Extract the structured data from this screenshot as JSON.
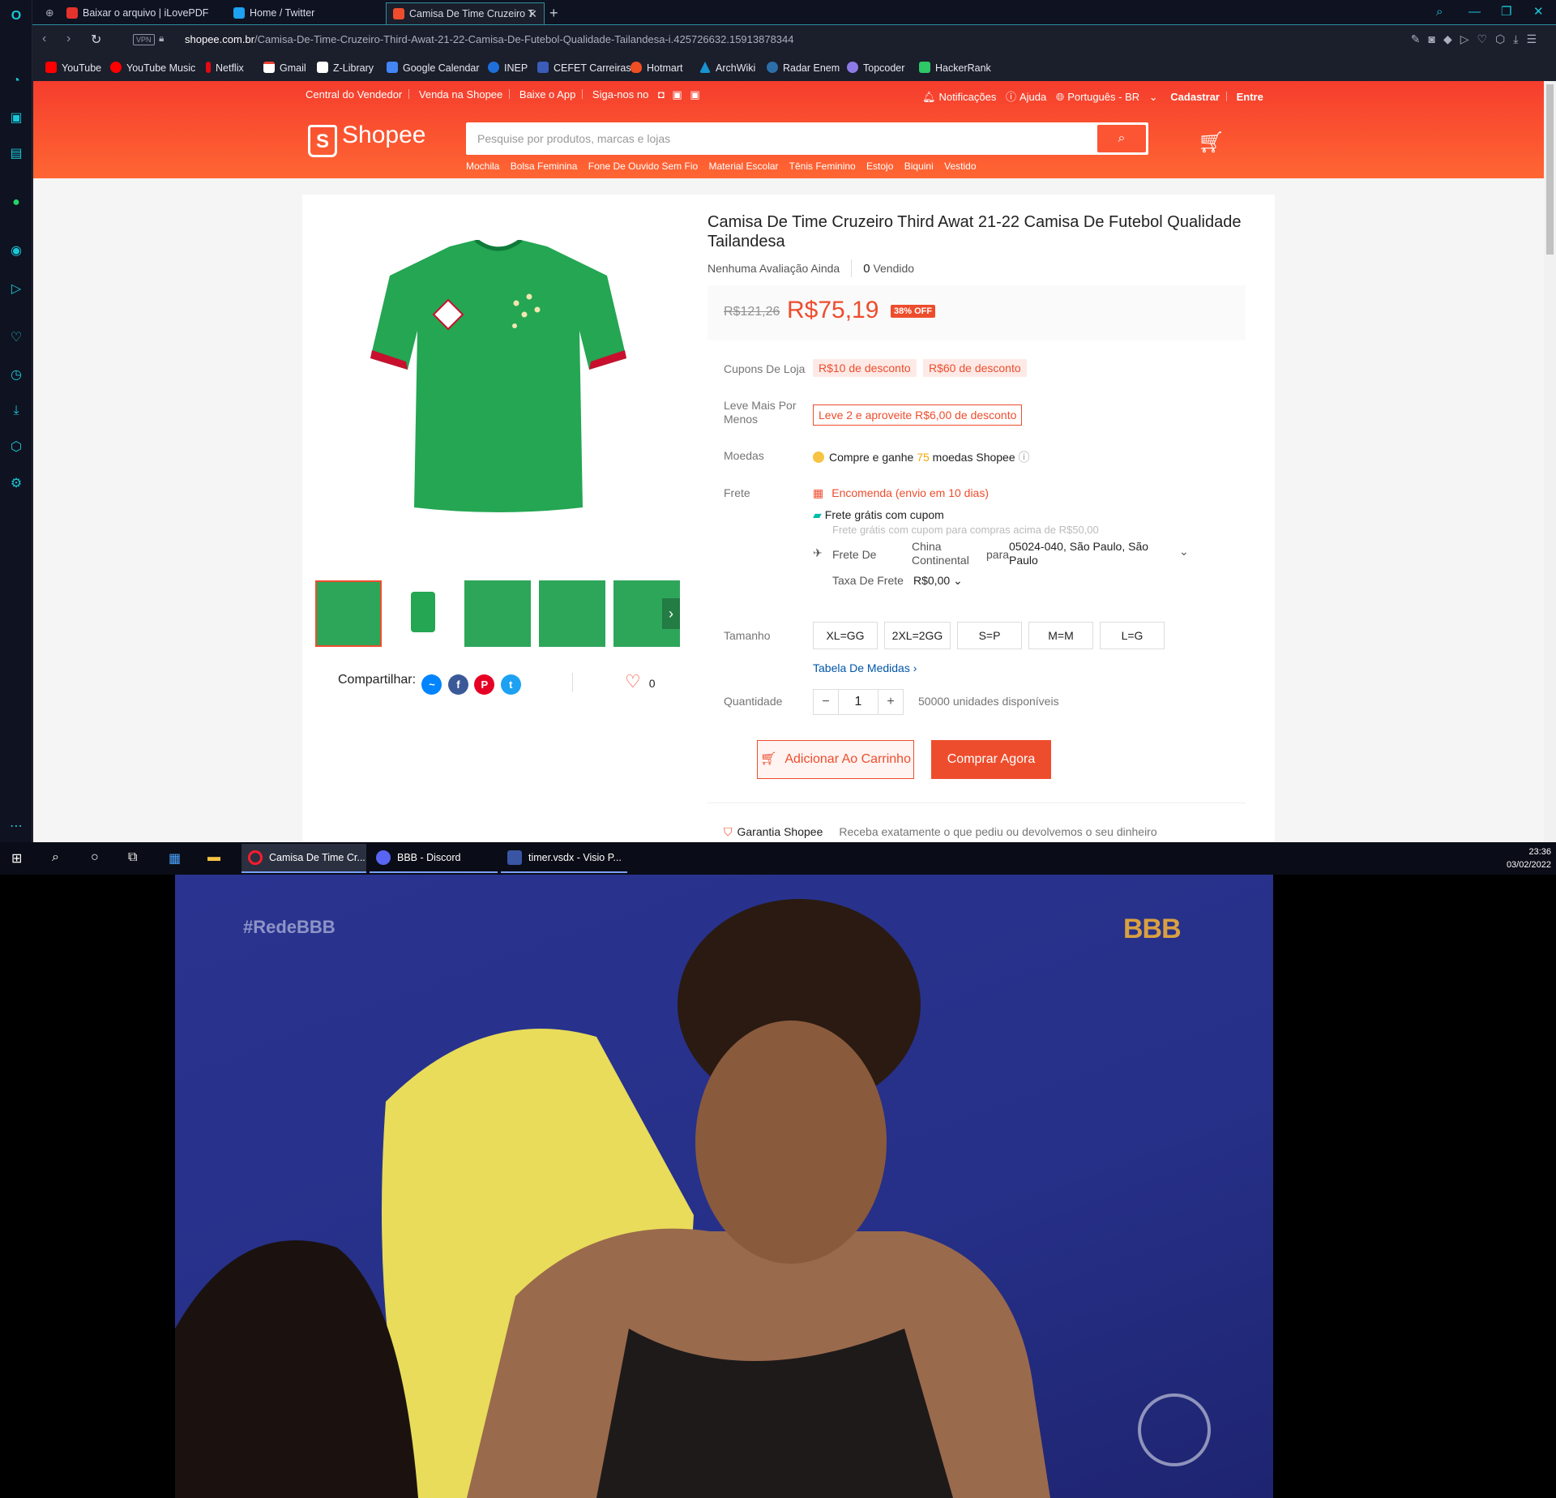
{
  "browser": {
    "tabs": [
      {
        "label": "Baixar o arquivo | iLovePDF"
      },
      {
        "label": "Home / Twitter"
      },
      {
        "label": "Camisa De Time Cruzeiro T"
      }
    ],
    "address": {
      "vpn": "VPN",
      "domain": "shopee.com.br",
      "path": "/Camisa-De-Time-Cruzeiro-Third-Awat-21-22-Camisa-De-Futebol-Qualidade-Tailandesa-i.425726632.15913878344"
    },
    "bookmarks": [
      "YouTube",
      "YouTube Music",
      "Netflix",
      "Gmail",
      "Z-Library",
      "Google Calendar",
      "INEP",
      "CEFET Carreiras",
      "Hotmart",
      "ArchWiki",
      "Radar Enem",
      "Topcoder",
      "HackerRank"
    ]
  },
  "shopee": {
    "topnav_left": [
      "Central do Vendedor",
      "Venda na Shopee",
      "Baixe o App",
      "Siga-nos no"
    ],
    "topnav_right": [
      "Notificações",
      "Ajuda",
      "Português - BR",
      "Cadastrar",
      "Entre"
    ],
    "logo": "Shopee",
    "search_placeholder": "Pesquise por produtos, marcas e lojas",
    "suggestions": [
      "Mochila",
      "Bolsa Feminina",
      "Fone De Ouvido Sem Fio",
      "Material Escolar",
      "Tênis Feminino",
      "Estojo",
      "Biquini",
      "Vestido"
    ]
  },
  "product": {
    "title": "Camisa De Time Cruzeiro Third Awat 21-22 Camisa De Futebol Qualidade Tailandesa",
    "rating": "Nenhuma Avaliação Ainda",
    "sold_count": "0",
    "sold_label": "Vendido",
    "old_price": "R$121,26",
    "price": "R$75,19",
    "discount": "38% OFF",
    "coupons_label": "Cupons De Loja",
    "coupons": [
      "R$10 de desconto",
      "R$60 de desconto"
    ],
    "combo_label": "Leve Mais Por Menos",
    "combo": "Leve 2 e aproveite R$6,00 de desconto",
    "coins_label": "Moedas",
    "coins_pre": "Compre e ganhe",
    "coins_amount": "75",
    "coins_post": "moedas Shopee",
    "shipping_label": "Frete",
    "shipping_eta": "Encomenda (envio em 10 dias)",
    "free_shipping": "Frete grátis com cupom",
    "free_shipping_note": "Frete grátis com cupom para compras acima de R$50,00",
    "ship_from_label": "Frete De",
    "ship_from": "China Continental",
    "ship_to_label": "para",
    "ship_to": "05024-040, São Paulo, São Paulo",
    "ship_fee_label": "Taxa De Frete",
    "ship_fee": "R$0,00",
    "size_label": "Tamanho",
    "sizes": [
      "XL=GG",
      "2XL=2GG",
      "S=P",
      "M=M",
      "L=G"
    ],
    "size_table": "Tabela De Medidas",
    "qty_label": "Quantidade",
    "qty_value": "1",
    "stock": "50000 unidades disponíveis",
    "add_to_cart": "Adicionar Ao Carrinho",
    "buy_now": "Comprar Agora",
    "guarantee_title": "Garantia Shopee",
    "guarantee_text": "Receba exatamente o que pediu ou devolvemos o seu dinheiro",
    "share_label": "Compartilhar:",
    "likes": "0"
  },
  "taskbar": {
    "apps": [
      "Camisa De Time Cr...",
      "BBB - Discord",
      "timer.vsdx - Visio P..."
    ],
    "time": "23:36",
    "date": "03/02/2022"
  },
  "video": {
    "hashtag": "#RedeBBB",
    "logo": "BBB"
  },
  "colors": {
    "shopee_orange": "#ee4d2d",
    "opera_accent": "#18c8d8",
    "shirt_green": "#24a653"
  }
}
